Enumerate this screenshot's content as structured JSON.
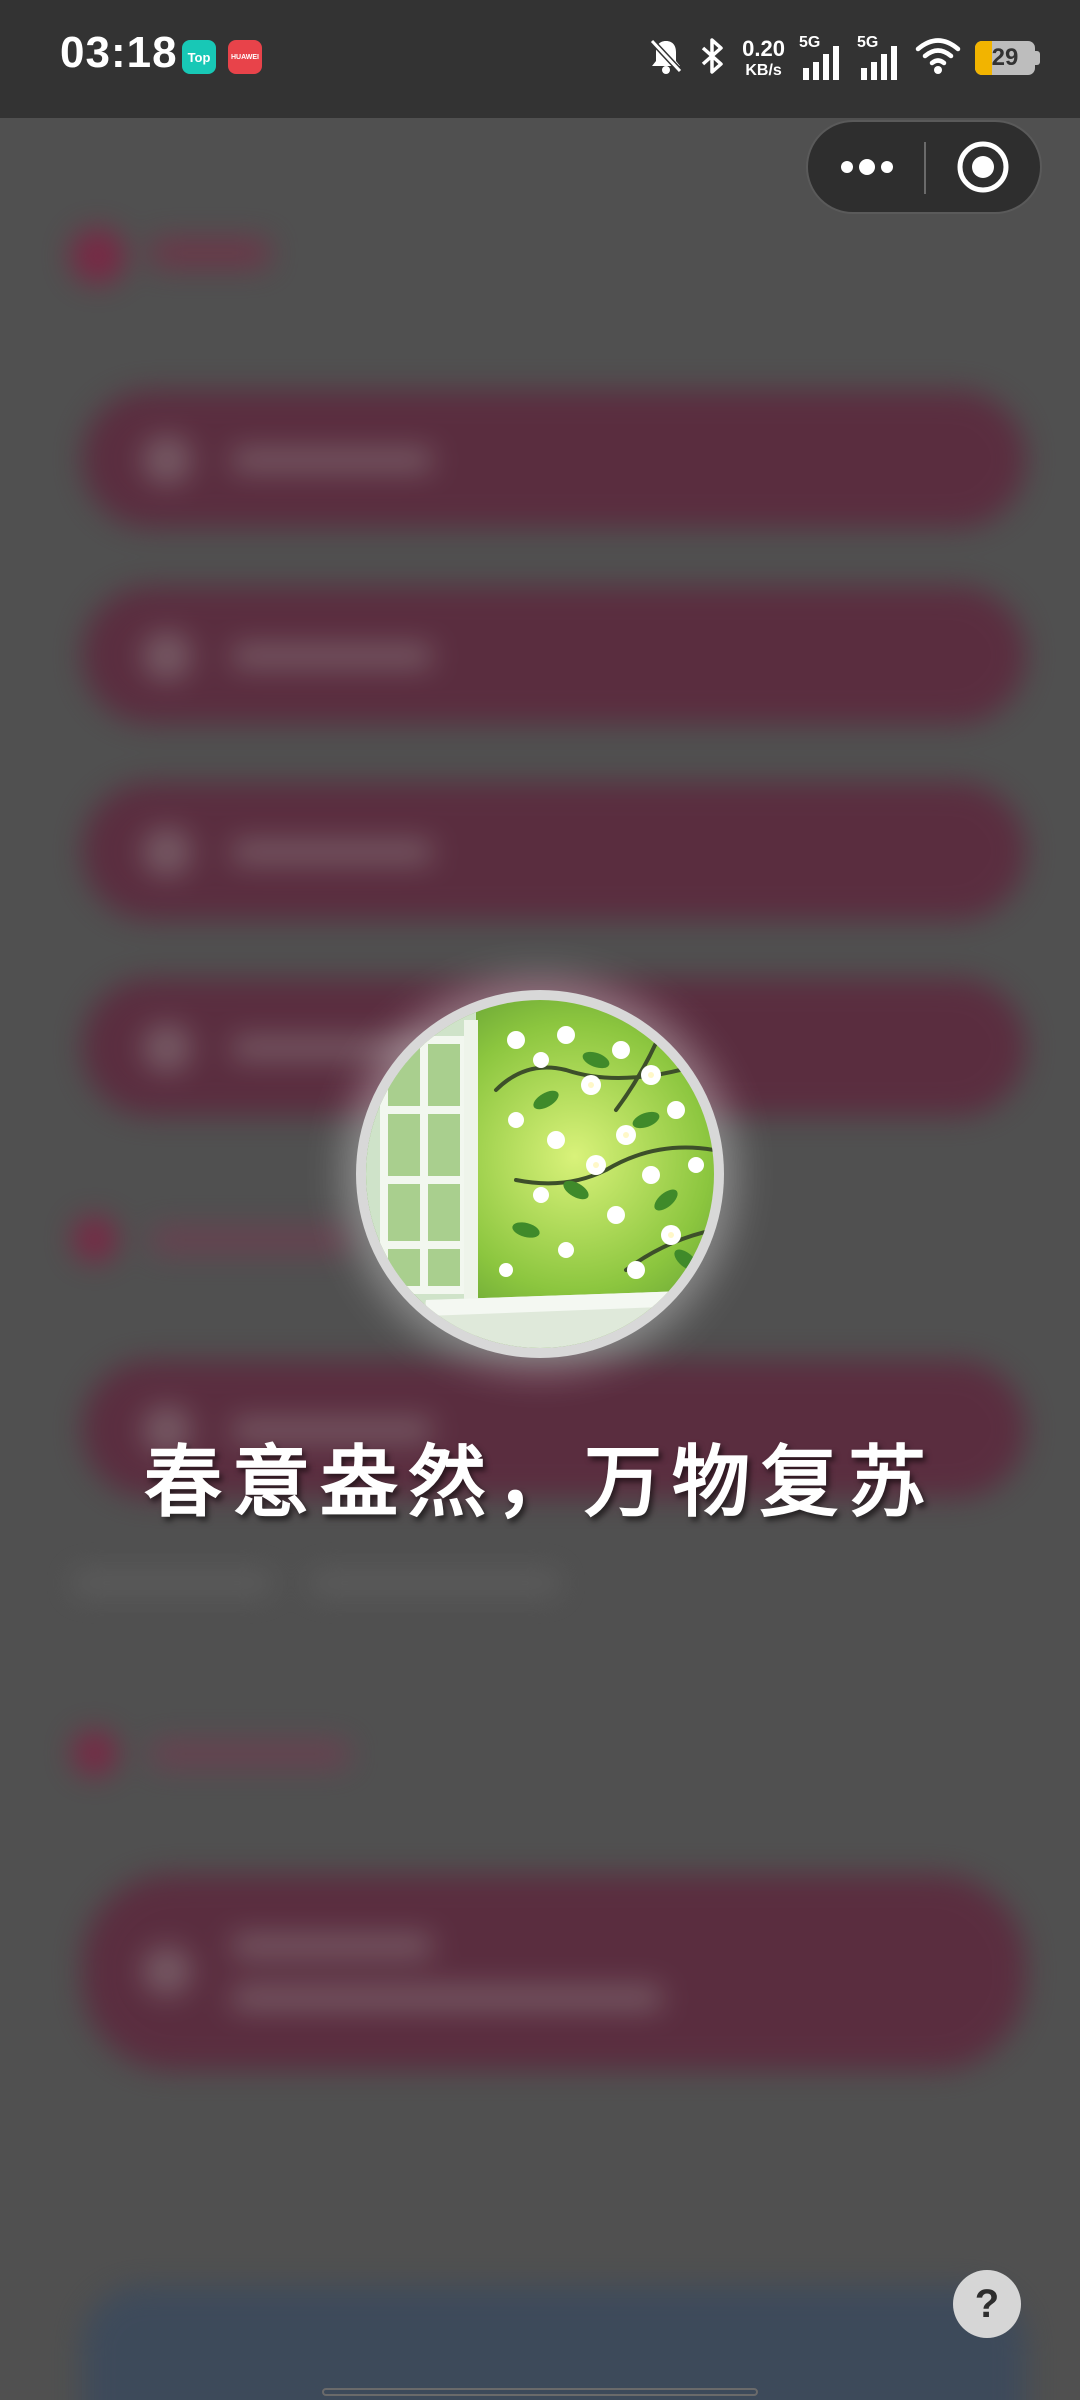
{
  "status_bar": {
    "time": "03:18",
    "app_badges": [
      {
        "icon": "top-app-icon",
        "label": "Top"
      },
      {
        "icon": "huawei-store-icon",
        "label": "HUAWEI"
      }
    ],
    "icons": [
      "mute-bell-icon",
      "bluetooth-icon"
    ],
    "network_speed": {
      "value": "0.20",
      "unit": "KB/s"
    },
    "signals": [
      {
        "label": "5G"
      },
      {
        "label": "5G"
      }
    ],
    "wifi": "wifi-icon",
    "battery": {
      "level": 29,
      "text": "29",
      "fill_color": "#f2b400"
    }
  },
  "capsule_menu": {
    "more_icon": "more-dots-icon",
    "close_icon": "target-close-icon"
  },
  "splash": {
    "image": "spring-window-blossom",
    "text": "春意盎然，万物复苏"
  },
  "help_button": {
    "label": "?"
  },
  "colors": {
    "overlay": "#505050",
    "pill": "#5c2a3e",
    "accent": "#7c2544",
    "status_bar": "#333333"
  }
}
